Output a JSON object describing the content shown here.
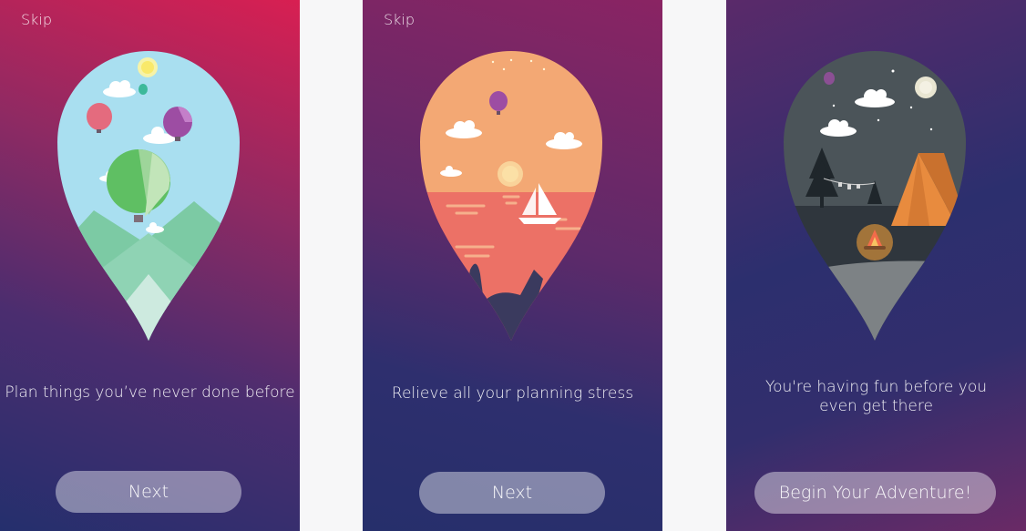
{
  "screens": [
    {
      "skip_label": "Skip",
      "caption": "Plan things you’ve never done before",
      "button_label": "Next"
    },
    {
      "skip_label": "Skip",
      "caption": "Relieve all your planning stress",
      "button_label": "Next"
    },
    {
      "caption": "You're having fun before you even get there",
      "button_label": "Begin Your Adventure!"
    }
  ],
  "colors": {
    "screen1_top": "#d81f52",
    "screen_bottom": "#262f6b",
    "button_fill": "rgba(255,255,255,0.42)",
    "text": "#ffffff"
  },
  "illustrations": [
    "hot-air-balloons-illustration",
    "sunset-sailboat-illustration",
    "night-camping-illustration"
  ]
}
